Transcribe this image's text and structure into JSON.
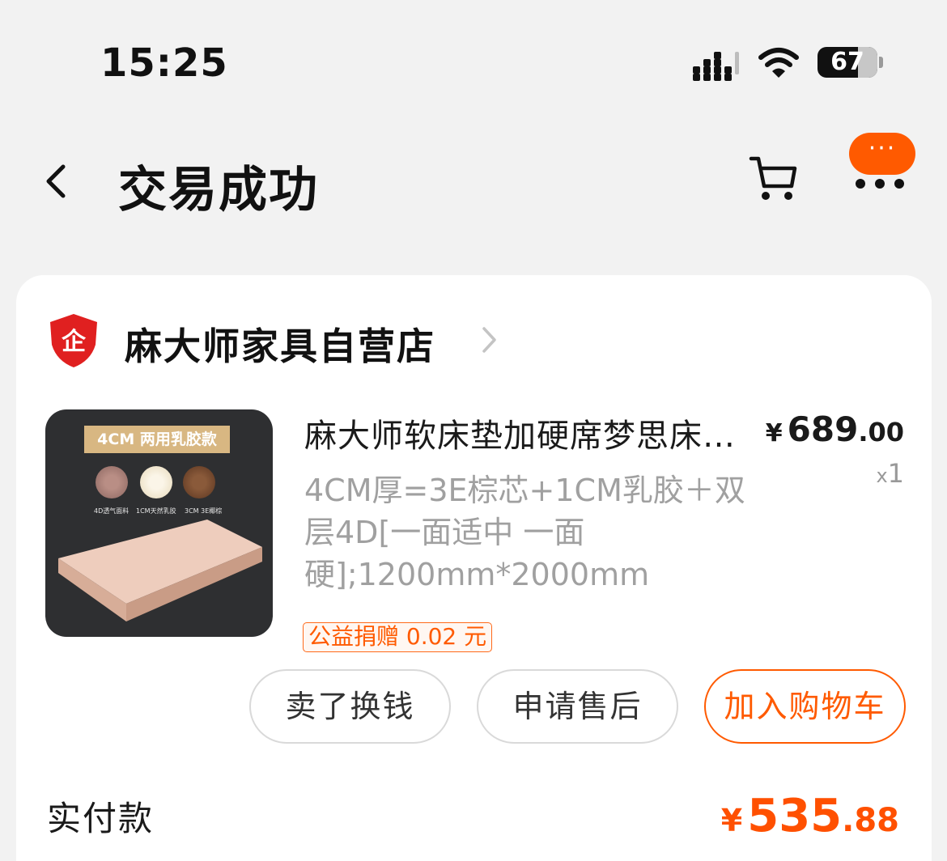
{
  "status_bar": {
    "time": "15:25",
    "battery": "67",
    "battery_level_percent": 67
  },
  "nav": {
    "title": "交易成功",
    "message_badge": "···"
  },
  "shop": {
    "name": "麻大师家具自营店",
    "badge_glyph": "企"
  },
  "product": {
    "title": "麻大师软床垫加硬席梦思床垫家用卧室椰棕床垫",
    "spec": "4CM厚=3E棕芯+1CM乳胶＋双层4D[一面适中 一面硬];1200mm*2000mm",
    "price_symbol": "¥",
    "price_int": "689",
    "price_dec": ".00",
    "qty_prefix": "x",
    "qty": "1",
    "charity": "公益捐赠 0.02 元",
    "image": {
      "tag": "4CM 两用乳胶款",
      "layers": [
        "4D透气面料",
        "1CM天然乳胶",
        "3CM 3E椰棕"
      ]
    }
  },
  "actions": {
    "sell": "卖了换钱",
    "after_sale": "申请售后",
    "add_cart": "加入购物车"
  },
  "payment": {
    "label": "实付款",
    "symbol": "¥",
    "int": "535",
    "dec": ".88"
  },
  "colors": {
    "accent": "#ff5a00",
    "background": "#f2f2f2",
    "card": "#ffffff",
    "shop_badge": "#e02020"
  }
}
